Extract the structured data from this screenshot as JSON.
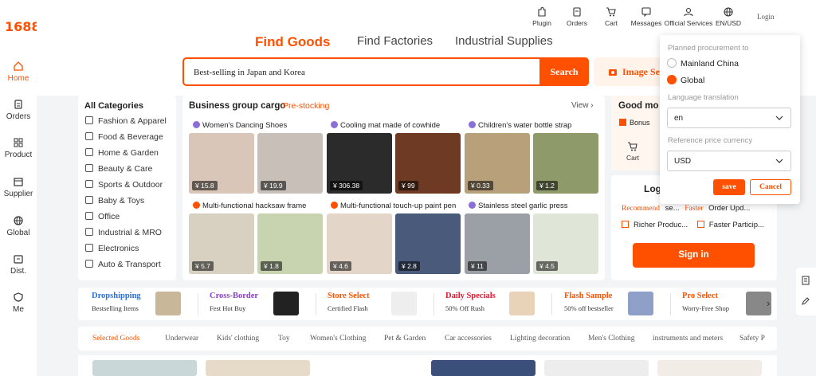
{
  "logo": "1688",
  "sidebar": {
    "items": [
      {
        "label": "Home"
      },
      {
        "label": "Orders"
      },
      {
        "label": "Product"
      },
      {
        "label": "Supplier"
      },
      {
        "label": "Global"
      },
      {
        "label": "Dist."
      },
      {
        "label": "Me"
      }
    ]
  },
  "topnav": {
    "items": [
      {
        "label": "Plugin"
      },
      {
        "label": "Orders"
      },
      {
        "label": "Cart"
      },
      {
        "label": "Messages"
      },
      {
        "label": "Official Services"
      },
      {
        "label": "EN/USD"
      }
    ],
    "login": "Login"
  },
  "tabs": {
    "goods": "Find Goods",
    "factories": "Find Factories",
    "supplies": "Industrial Supplies"
  },
  "search": {
    "value": "Best-selling in Japan and Korea",
    "button": "Search",
    "image_search": "Image Se"
  },
  "categories": {
    "title": "All Categories",
    "items": [
      "Fashion & Apparel",
      "Food & Beverage",
      "Home & Garden",
      "Beauty & Care",
      "Sports & Outdoor",
      "Baby & Toys",
      "Office",
      "Industrial & MRO",
      "Electronics",
      "Auto & Transport"
    ]
  },
  "business": {
    "title": "Business group cargo",
    "tag": "Pre-stocking",
    "view": "View",
    "groups": [
      {
        "title": "Women's Dancing Shoes",
        "prices": [
          "¥ 15.8",
          "¥ 19.9"
        ]
      },
      {
        "title": "Cooling mat made of cowhide",
        "prices": [
          "¥ 306.38",
          "¥ 99"
        ]
      },
      {
        "title": "Children's water bottle strap",
        "prices": [
          "¥ 0.33",
          "¥ 1.2"
        ]
      },
      {
        "title": "Multi-functional hacksaw frame",
        "prices": [
          "¥ 5.7",
          "¥ 1.8"
        ]
      },
      {
        "title": "Multi-functional touch-up paint pen",
        "prices": [
          "¥ 4.6",
          "¥ 2.8"
        ]
      },
      {
        "title": "Stainless steel garlic press",
        "prices": [
          "¥ 11",
          "¥ 4.5"
        ]
      }
    ]
  },
  "right": {
    "good_more": "Good mo",
    "bonus": "Bonus",
    "cart": "Cart",
    "login": "Log",
    "recommend": "Recommend",
    "recommend2": "se...",
    "faster": "Faster",
    "order_upd": "Order Upd...",
    "richer": "Richer Produc...",
    "faster_p": "Faster Particip...",
    "sign_in": "Sign in"
  },
  "popup": {
    "procurement_label": "Planned procurement to",
    "options": [
      "Mainland China",
      "Global"
    ],
    "selected": "Global",
    "language_label": "Language translation",
    "language": "en",
    "currency_label": "Reference price currency",
    "currency": "USD",
    "save": "save",
    "cancel": "Cancel"
  },
  "promos": [
    {
      "title": "Dropshipping",
      "sub": "Bestselling Items",
      "color": "#2d6fd8"
    },
    {
      "title": "Cross-Border",
      "sub": "Fest Hot Buy",
      "color": "#8a3fc7"
    },
    {
      "title": "Store Select",
      "sub": "Certified Flash",
      "color": "#ff5000"
    },
    {
      "title": "Daily Specials",
      "sub": "50% Off Rush",
      "color": "#e0182d"
    },
    {
      "title": "Flash Sample",
      "sub": "50% off bestseller",
      "color": "#ff5000"
    },
    {
      "title": "Pro Select",
      "sub": "Worry-Free Shop",
      "color": "#ff5000"
    }
  ],
  "goods_tabs": [
    "Selected Goods",
    "Underwear",
    "Kids' clothing",
    "Toy",
    "Women's Clothing",
    "Pet & Garden",
    "Car accessories",
    "Lighting decoration",
    "Men's Clothing",
    "instruments and meters",
    "Safety P"
  ],
  "colors": {
    "accent": "#ff5000"
  }
}
